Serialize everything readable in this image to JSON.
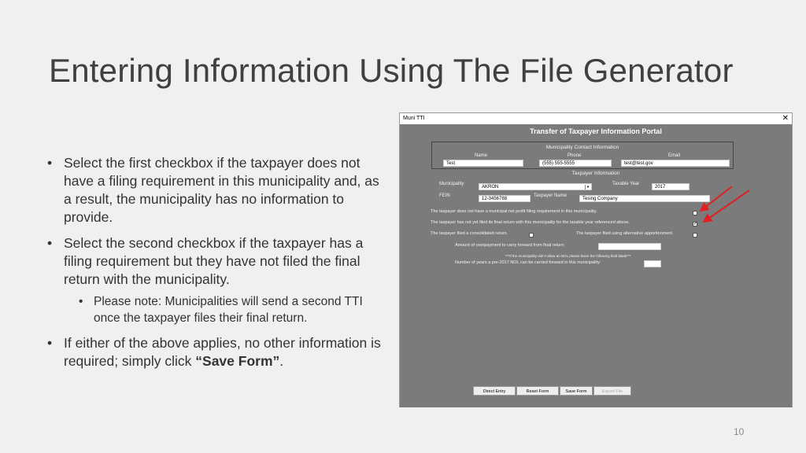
{
  "slide": {
    "title": "Entering Information Using The File Generator",
    "page_number": "10",
    "bullets": {
      "b1": "Select the first checkbox if the taxpayer does not have a filing requirement in this municipality and, as a result, the municipality has no information to provide.",
      "b2": "Select the second checkbox if the taxpayer has a filing requirement but they have not filed the final return with the municipality.",
      "b2_sub": "Please note: Municipalities will send a second TTI once the taxpayer files their final return.",
      "b3_text": "If either of the above applies, no other information is required; simply click ",
      "b3_bold": "“Save Form”",
      "b3_end": "."
    }
  },
  "window": {
    "title": "Muni TTI",
    "close": "✕",
    "portal_title": "Transfer of Taxpayer Information Portal",
    "contact": {
      "heading": "Municipality Contact Information",
      "name_label": "Name",
      "phone_label": "Phone",
      "email_label": "Email",
      "name_value": "Test",
      "phone_value": "(555) 555-5555",
      "email_value": "test@test.gov"
    },
    "taxpayer": {
      "heading": "Taxpayer Information",
      "municipality_label": "Municipality",
      "municipality_value": "AKRON",
      "taxable_year_label": "Taxable Year",
      "taxable_year_value": "2017",
      "fein_label": "FEIN",
      "fein_value": "12-3456788",
      "taxpayer_name_label": "Taxpayer Name",
      "taxpayer_name_value": "Tesing Company"
    },
    "checks": {
      "no_requirement": "The taxpayer does not have a municipal net profit filing requirement in this municipality.",
      "not_filed": "The taxpayer has not yet filed its final return with this municipality for the taxable year referenced above.",
      "consolidated": "The taxpayer filed a consolidated return.",
      "alt_apportion": "The taxpayer filed using alternative apportionment.",
      "not_filed_mark": "✓"
    },
    "overpayment_label": "Amount of overpayment to carry forward from final return:",
    "nol_note": "***If the municipality didn't allow an NOL please leave the following field blank***",
    "nol_years_label": "Number of years a pre-2017 NOL can be carried forward in this municipality:",
    "buttons": {
      "direct_entry": "Direct Entry",
      "reset_form": "Reset Form",
      "save_form": "Save Form",
      "export_file": "Export File"
    }
  },
  "colors": {
    "arrow": "#e02020",
    "window_bg": "#7b7b7b"
  }
}
